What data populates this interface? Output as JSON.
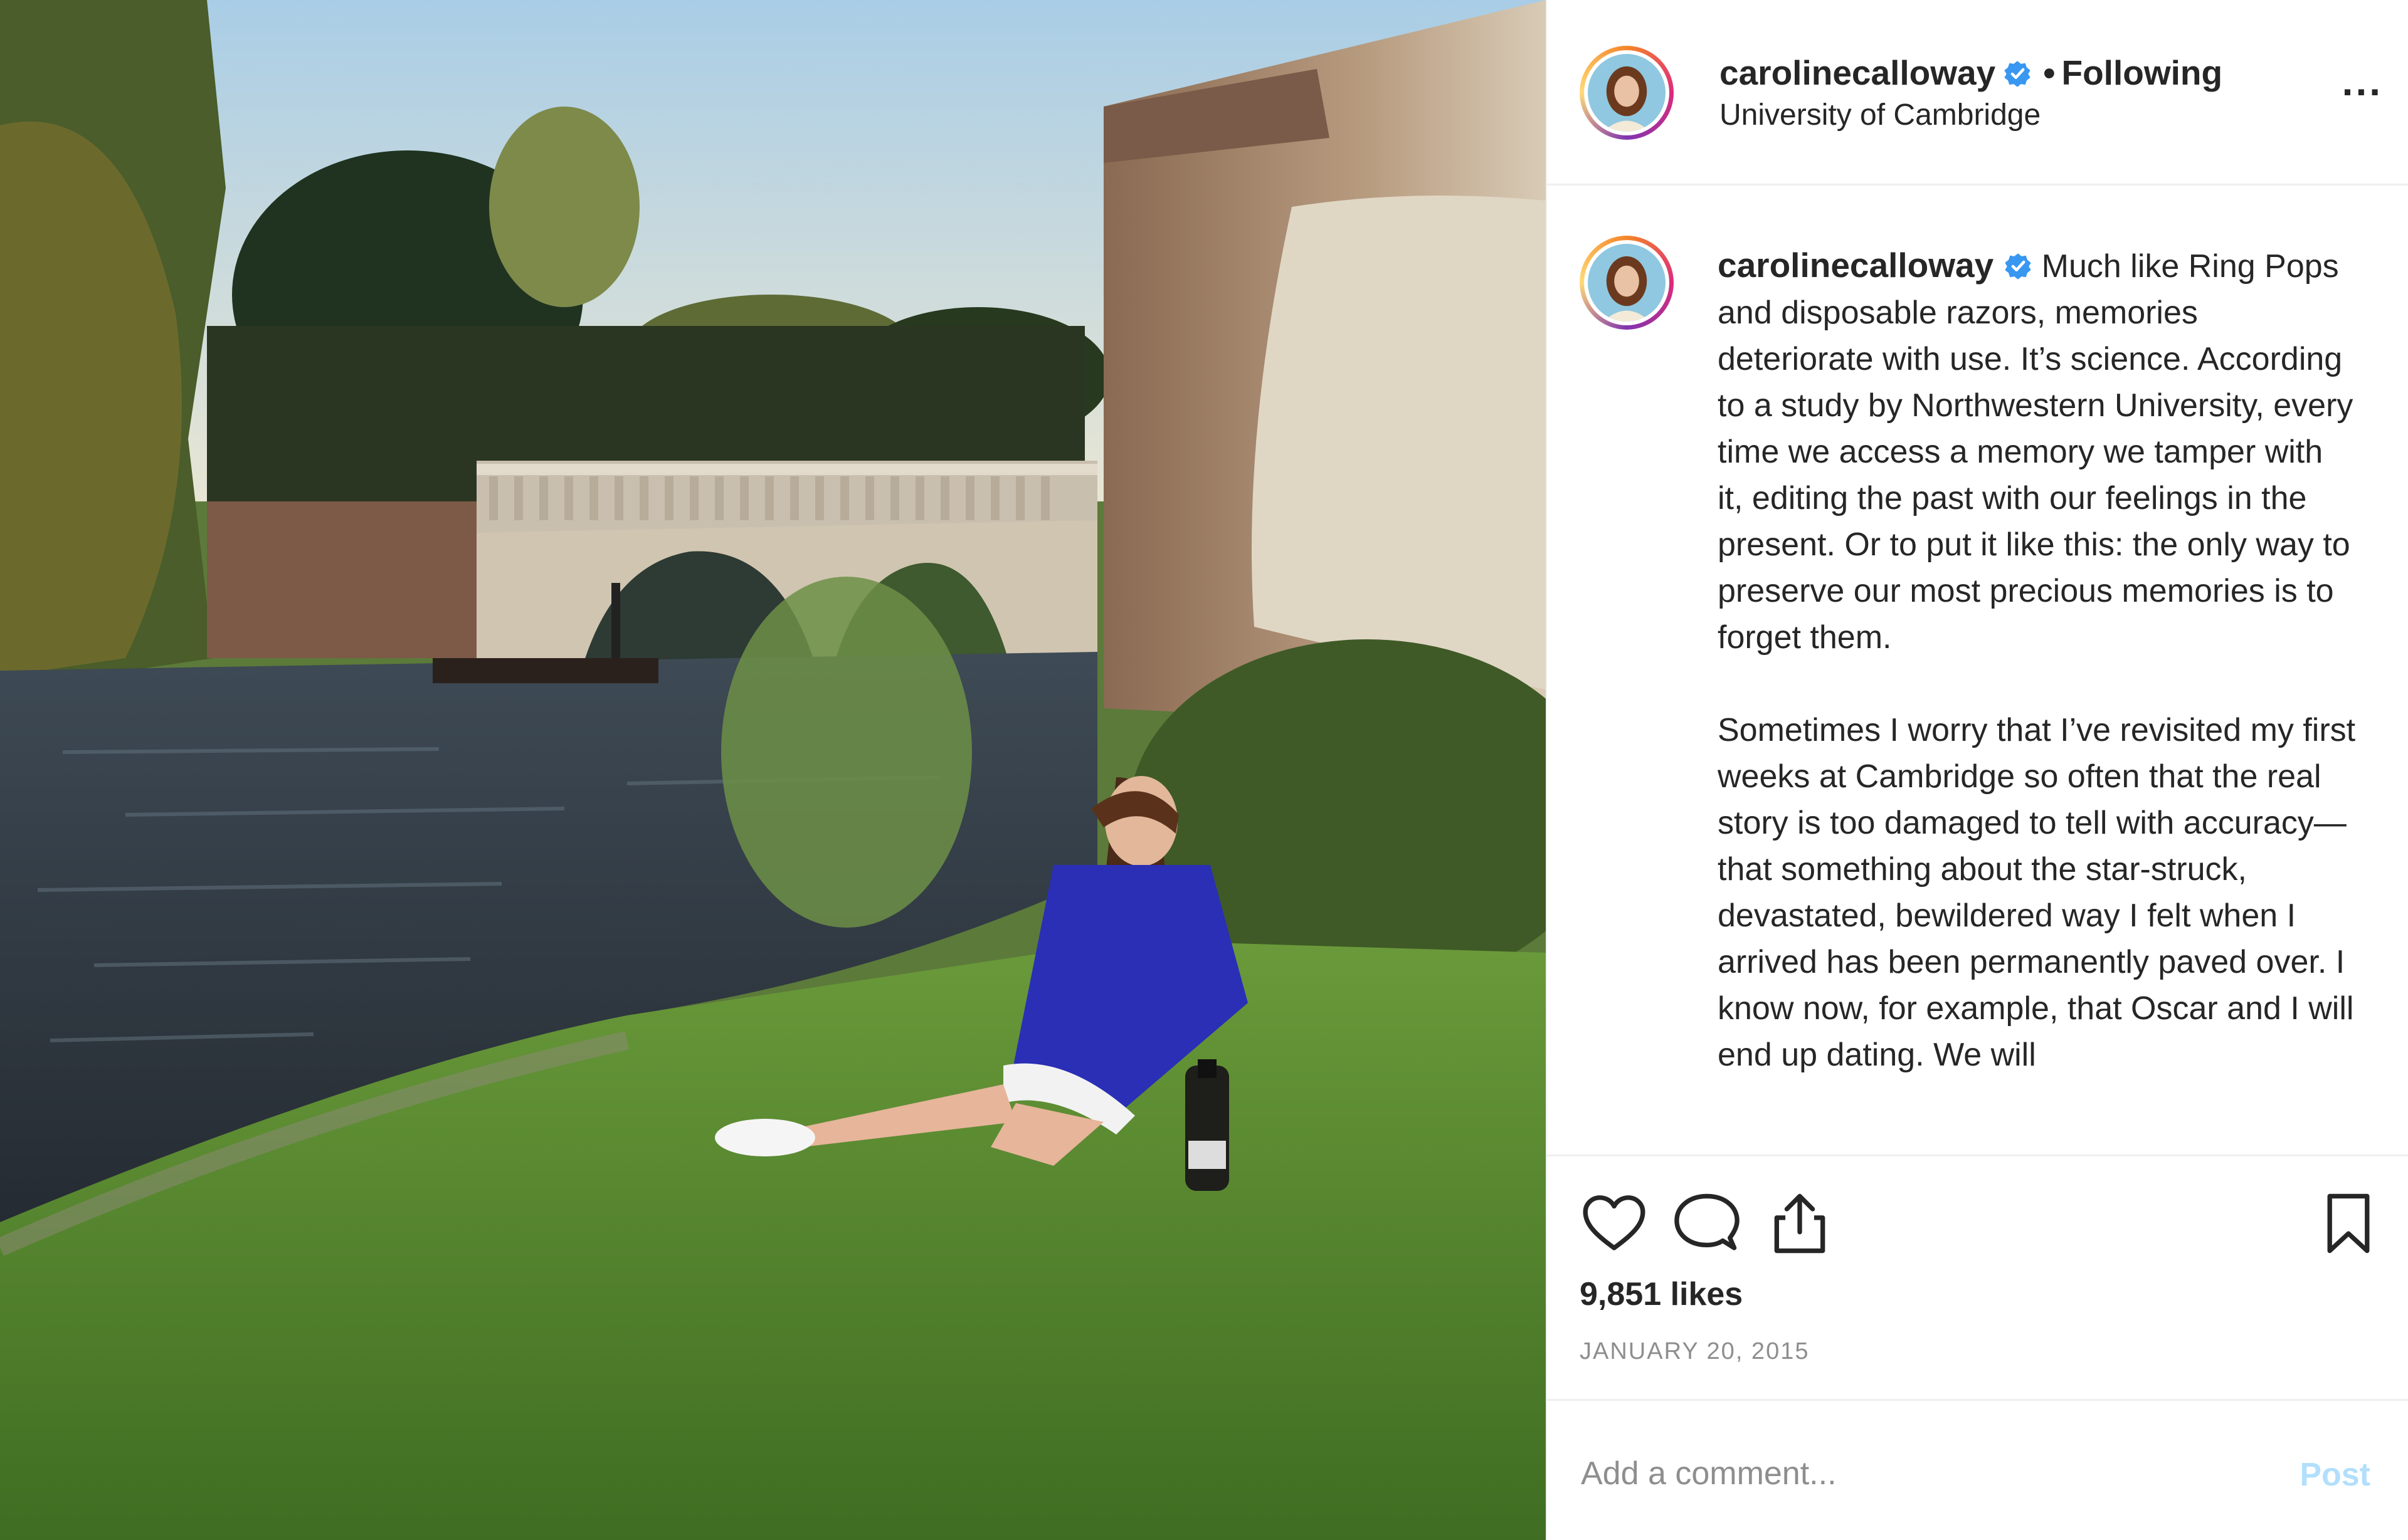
{
  "post": {
    "username": "carolinecalloway",
    "follow_separator": "•",
    "follow_status": "Following",
    "location": "University of Cambridge",
    "more_options": "...",
    "caption_paragraphs": [
      "Much like Ring Pops and disposable razors, memories deteriorate with use. It’s science. According to a study by Northwestern University, every time we access a memory we tamper with it, editing the past with our feelings in the present. Or to put it like this: the only way to preserve our most precious memories is to forget them.",
      "Sometimes I worry that I’ve revisited my first weeks at Cambridge so often that the real story is too damaged to tell with accuracy—that something about the star-struck, devastated, bewildered way I felt when I arrived has been permanently paved over. I know now, for example, that Oscar and I will end up dating. We will"
    ],
    "likes": "9,851 likes",
    "date": "JANUARY 20, 2015"
  },
  "comment": {
    "placeholder": "Add a comment...",
    "post_label": "Post"
  },
  "icons": {
    "like": "heart-icon",
    "comment": "comment-bubble-icon",
    "share": "share-icon",
    "save": "bookmark-icon",
    "verified": "verified-badge-icon",
    "more": "more-options-icon"
  },
  "colors": {
    "verified_blue": "#3897f0",
    "post_button_disabled": "#b2dffc",
    "muted_text": "#8e8e8e",
    "divider": "#efefef"
  }
}
